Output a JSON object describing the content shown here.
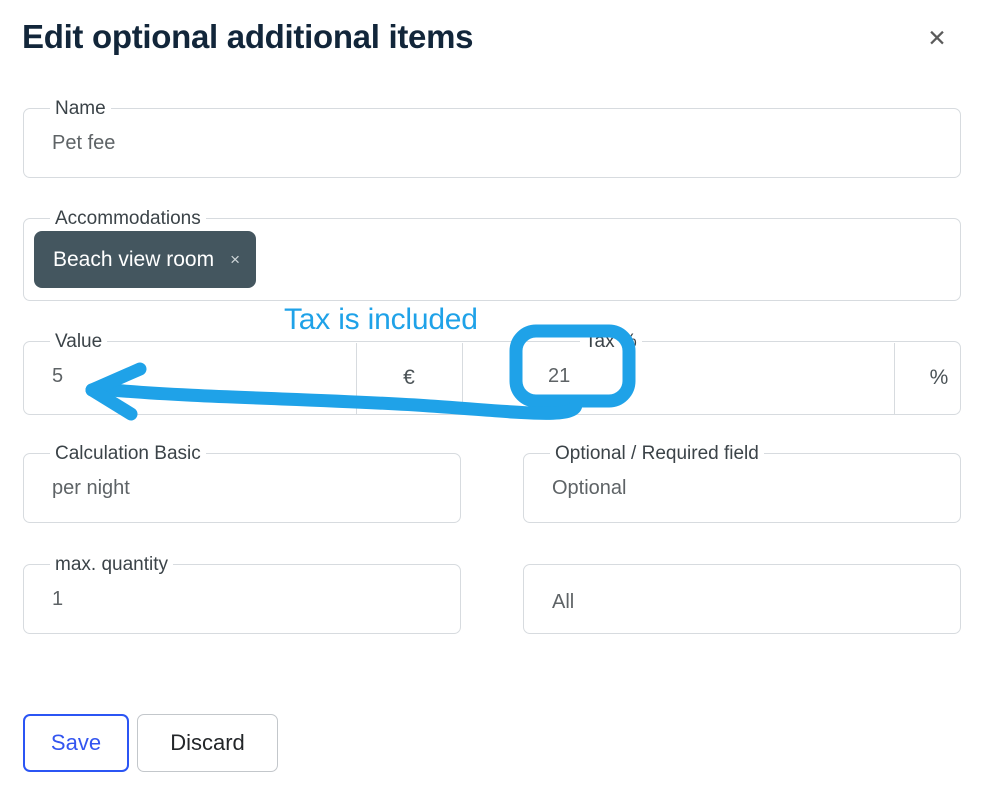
{
  "dialog": {
    "title": "Edit optional additional items",
    "close_icon": "close-icon",
    "close_glyph": "✕"
  },
  "fields": {
    "name": {
      "label": "Name",
      "value": "Pet fee",
      "placeholder": "Name"
    },
    "accommodations": {
      "label": "Accommodations",
      "chips": [
        {
          "label": "Beach view room",
          "remove_glyph": "×",
          "remove_icon": "chip-remove-icon"
        }
      ]
    },
    "value": {
      "label": "Value",
      "value": "5",
      "suffix": "€",
      "suffix_icon": "euro-icon"
    },
    "tax": {
      "label": "Tax %",
      "value": "21",
      "suffix": "%",
      "suffix_icon": "percent-icon"
    },
    "calculation_basic": {
      "label": "Calculation Basic",
      "value": "per night"
    },
    "optional_required": {
      "label": "Optional / Required field",
      "value": "Optional"
    },
    "max_quantity": {
      "label": "max. quantity",
      "value": "1"
    },
    "scope": {
      "label": "",
      "value": "All"
    }
  },
  "buttons": {
    "save": "Save",
    "discard": "Discard"
  },
  "annotation": {
    "note": "Tax is included",
    "color": "#1fa2e8",
    "highlight_target": "tax-percent-field",
    "arrow_target": "value-field"
  },
  "colors": {
    "title": "#12263a",
    "field_border": "#d7dbdf",
    "chip_bg": "#44565f",
    "save_accent": "#2b55f4",
    "annotation": "#1fa2e8"
  }
}
